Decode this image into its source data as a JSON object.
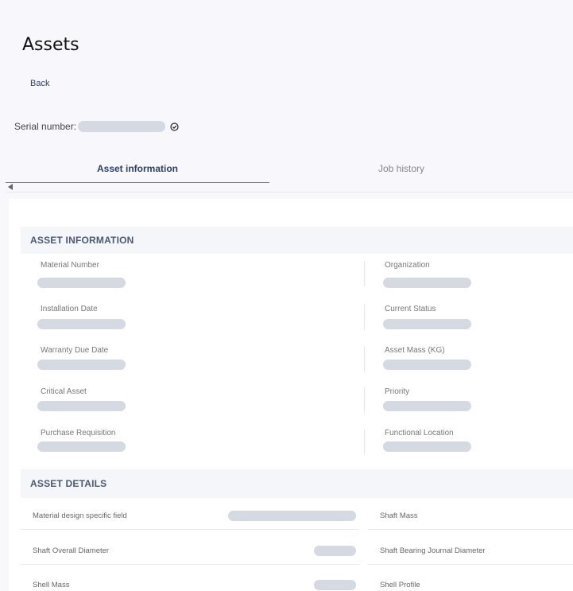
{
  "page": {
    "title": "Assets",
    "back_label": "Back"
  },
  "serial": {
    "label": "Serial number:"
  },
  "tabs": [
    "Asset information",
    "Job history"
  ],
  "asset_information": {
    "header": "ASSET INFORMATION",
    "left_fields": [
      "Material Number",
      "Installation Date",
      "Warranty Due Date",
      "Critical Asset",
      "Purchase Requisition"
    ],
    "right_fields": [
      "Organization",
      "Current Status",
      "Asset Mass (KG)",
      "Priority",
      "Functional Location"
    ]
  },
  "asset_details": {
    "header": "ASSET DETAILS",
    "left_rows": [
      "Material design specific field",
      "Shaft Overall Diameter",
      "Shell Mass"
    ],
    "right_rows": [
      "Shaft Mass",
      "Shaft Bearing Journal Diameter",
      "Shell Profile"
    ]
  },
  "colors": {
    "accent": "#5b7bd5",
    "placeholder": "#d4d9e2",
    "header_text": "#4b5a72"
  }
}
